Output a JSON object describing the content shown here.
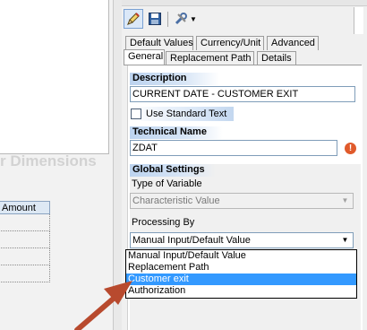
{
  "left_pane": {
    "dimensions_text": "r Dimensions",
    "amount_header": "Amount"
  },
  "toolbar": {
    "pencil_icon": "pencil-icon",
    "save_icon": "save-icon",
    "tools_icon": "tools-icon"
  },
  "tabs": {
    "row1": [
      "Default Values",
      "Currency/Unit",
      "Advanced"
    ],
    "row2": [
      "General",
      "Replacement Path",
      "Details"
    ],
    "active": "General"
  },
  "description": {
    "header": "Description",
    "value": "CURRENT DATE - CUSTOMER EXIT",
    "use_standard_text_label": "Use Standard Text",
    "use_standard_text_checked": false
  },
  "technical_name": {
    "header": "Technical Name",
    "value": "ZDAT"
  },
  "global_settings": {
    "header": "Global Settings",
    "type_label": "Type of Variable",
    "type_value": "Characteristic Value",
    "processing_label": "Processing By",
    "processing_value": "Manual Input/Default Value",
    "processing_options": [
      "Manual Input/Default Value",
      "Replacement Path",
      "Customer exit",
      "Authorization"
    ],
    "highlighted_option": "Customer exit"
  },
  "colors": {
    "selection": "#3399ff",
    "arrow": "#b84a2e",
    "section_header": "#bcd3ef",
    "error": "#e05a2b"
  }
}
